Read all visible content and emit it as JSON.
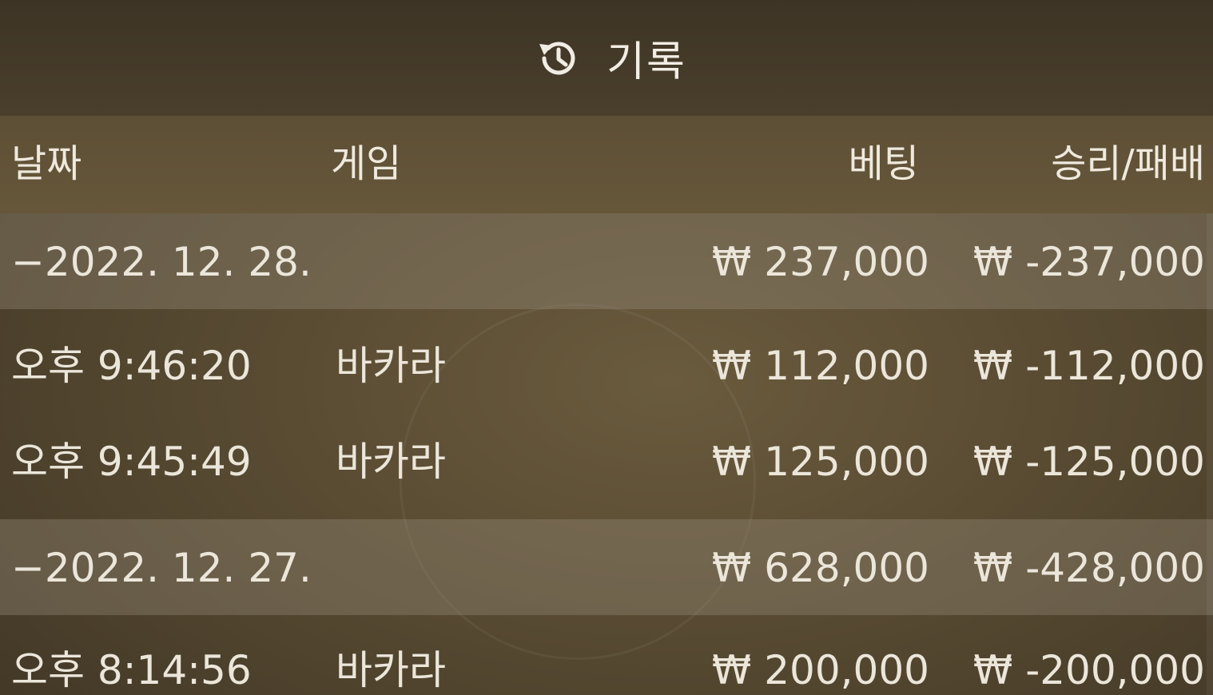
{
  "header": {
    "title": "기록",
    "icon": "history-icon"
  },
  "columns": {
    "date": "날짜",
    "game": "게임",
    "bet": "베팅",
    "result": "승리/패배"
  },
  "groups": [
    {
      "date": "−2022. 12. 28.",
      "bet_total": "₩ 237,000",
      "result_total": "₩ -237,000",
      "entries": [
        {
          "time": "오후 9:46:20",
          "game": "바카라",
          "bet": "₩ 112,000",
          "result": "₩ -112,000"
        },
        {
          "time": "오후 9:45:49",
          "game": "바카라",
          "bet": "₩ 125,000",
          "result": "₩ -125,000"
        }
      ]
    },
    {
      "date": "−2022. 12. 27.",
      "bet_total": "₩ 628,000",
      "result_total": "₩ -428,000",
      "entries": [
        {
          "time": "오후 8:14:56",
          "game": "바카라",
          "bet": "₩ 200,000",
          "result": "₩ -200,000"
        }
      ]
    }
  ]
}
